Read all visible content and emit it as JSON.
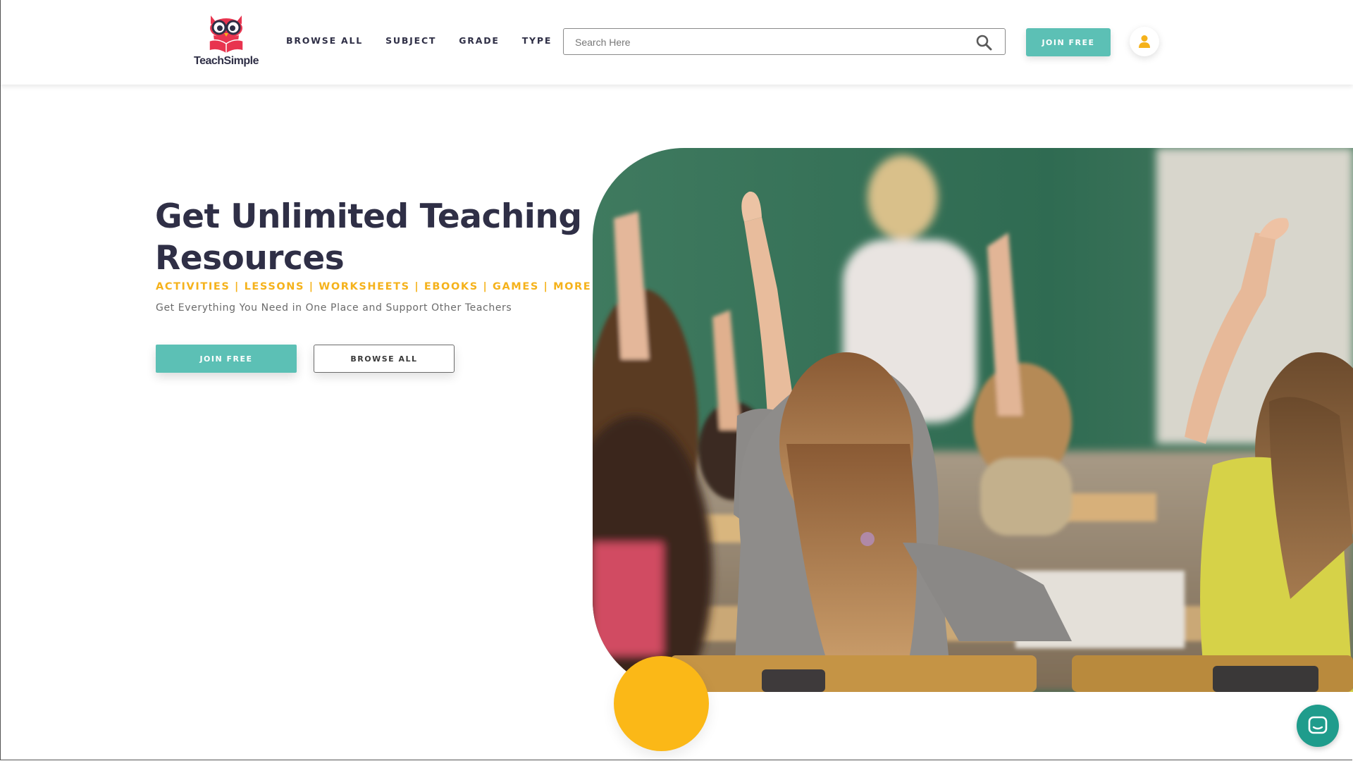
{
  "brand": {
    "name": "TeachSimple",
    "logo_icon": "owl-reading-book-icon",
    "colors": {
      "teal": "#5cc0b5",
      "yellow": "#fbb817",
      "category_text": "#f5b21b",
      "dark_text": "#2f2f46",
      "logo_red": "#e8344f",
      "chat_teal": "#1f9c8c"
    }
  },
  "nav": {
    "items": [
      {
        "label": "BROWSE ALL"
      },
      {
        "label": "SUBJECT"
      },
      {
        "label": "GRADE"
      },
      {
        "label": "TYPE"
      }
    ]
  },
  "search": {
    "placeholder": "Search Here",
    "value": "",
    "icon": "search-icon"
  },
  "header": {
    "join_label": "JOIN FREE",
    "account_icon": "user-icon"
  },
  "hero": {
    "title": "Get Unlimited Teaching Resources",
    "categories": "ACTIVITIES | LESSONS | WORKSHEETS | EBOOKS | GAMES | MORE",
    "subtitle": "Get Everything You Need in One Place and Support Other Teachers",
    "join_label": "JOIN FREE",
    "browse_label": "BROWSE ALL",
    "image_subject": "classroom-students-raising-hands"
  },
  "chat": {
    "icon": "chat-bubble-icon"
  }
}
